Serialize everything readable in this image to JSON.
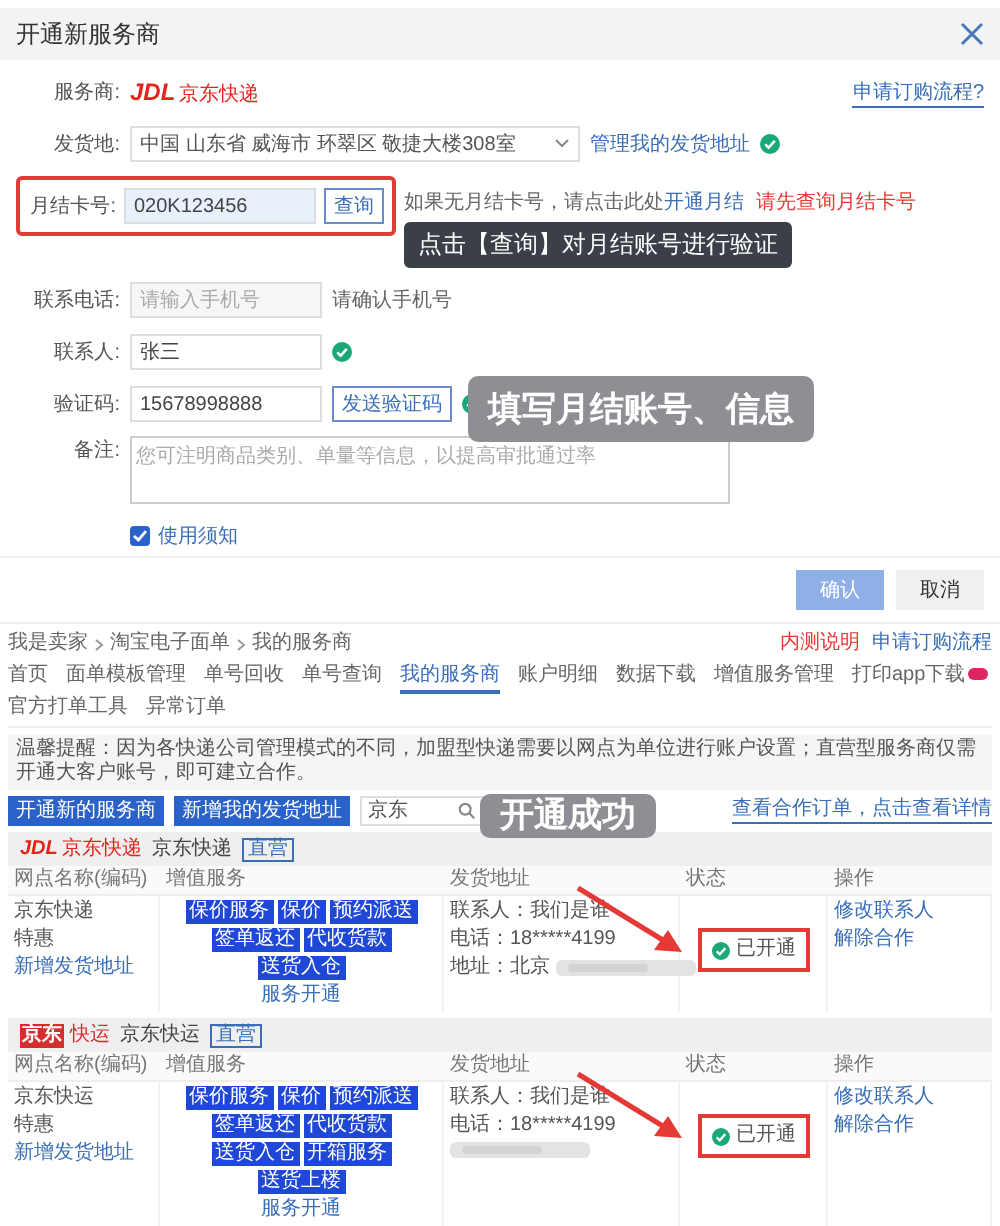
{
  "dialog": {
    "title": "开通新服务商",
    "help_link": "申请订购流程?",
    "provider": {
      "label": "服务商:",
      "logo_mark": "JDL",
      "logo_text": "京东快递"
    },
    "address": {
      "label": "发货地:",
      "value": "中国 山东省 威海市 环翠区 敬捷大楼308室",
      "link": "管理我的发货地址",
      "verified": true
    },
    "account": {
      "label": "月结卡号:",
      "value": "020K123456",
      "button": "查询",
      "hint": "如果无月结卡号，请点击此处",
      "hint_link": "开通月结",
      "warning": "请先查询月结卡号",
      "highlighted": true
    },
    "tooltip": "点击【查询】对月结账号进行验证",
    "phone": {
      "label": "联系电话:",
      "placeholder": "请输入手机号",
      "hint": "请确认手机号"
    },
    "contact": {
      "label": "联系人:",
      "value": "张三",
      "verified": true
    },
    "code": {
      "label": "验证码:",
      "value": "15678998888",
      "button": "发送验证码",
      "verified": true
    },
    "banner": "填写月结账号、信息",
    "note": {
      "label": "备注:",
      "placeholder": "您可注明商品类别、单量等信息，以提高审批通过率"
    },
    "agreement": {
      "label": "使用须知",
      "checked": true
    },
    "buttons": [
      {
        "label": "确认",
        "kind": "primary",
        "disabled": true
      },
      {
        "label": "取消",
        "kind": "default",
        "disabled": false
      }
    ]
  },
  "page": {
    "breadcrumb": [
      "我是卖家",
      "淘宝电子面单",
      "我的服务商"
    ],
    "top_links": [
      "内测说明",
      "申请订购流程"
    ],
    "tabs": [
      {
        "label": "首页",
        "selected": false,
        "badge": false
      },
      {
        "label": "面单模板管理",
        "selected": false,
        "badge": false
      },
      {
        "label": "单号回收",
        "selected": false,
        "badge": false
      },
      {
        "label": "单号查询",
        "selected": false,
        "badge": false
      },
      {
        "label": "我的服务商",
        "selected": true,
        "badge": false
      },
      {
        "label": "账户明细",
        "selected": false,
        "badge": false
      },
      {
        "label": "数据下载",
        "selected": false,
        "badge": false
      },
      {
        "label": "增值服务管理",
        "selected": false,
        "badge": false
      },
      {
        "label": "打印app下载",
        "selected": false,
        "badge": true
      },
      {
        "label": "官方打单工具",
        "selected": false,
        "badge": false
      },
      {
        "label": "异常订单",
        "selected": false,
        "badge": false
      }
    ],
    "notice": "温馨提醒：因为各快递公司管理模式的不同，加盟型快递需要以网点为单位进行账户设置；直营型服务商仅需开通大客户账号，即可建立合作。",
    "banner": "开通成功",
    "toolbar": {
      "buttons": [
        "开通新的服务商",
        "新增我的发货地址"
      ],
      "search_value": "京东",
      "link": "查看合作订单，点击查看详情"
    },
    "providers": [
      {
        "columns": [
          "网点名称(编码)",
          "增值服务",
          "发货地址",
          "状态",
          "操作"
        ],
        "kind": "jdl",
        "logo_mark": "JDL",
        "logo_text": "京东快递",
        "name": "京东快递",
        "tag": "直营",
        "site_name": "京东快递",
        "site_type": "特惠",
        "site_link": "新增发货地址",
        "services": [
          "保价服务",
          "保价",
          "预约派送",
          "签单返还",
          "代收货款",
          "送货入仓"
        ],
        "service_link": "服务开通",
        "contact": "联系人：我们是谁",
        "phone": "电话：18*****4199",
        "address": "地址：北京",
        "status": "已开通",
        "status_highlighted": true,
        "actions": [
          "修改联系人",
          "解除合作"
        ]
      },
      {
        "columns": [
          "网点名称(编码)",
          "增值服务",
          "发货地址",
          "状态",
          "操作"
        ],
        "kind": "freight",
        "logo_mark": "京东",
        "logo_text": "快运",
        "name": "京东快运",
        "tag": "直营",
        "site_name": "京东快运",
        "site_type": "特惠",
        "site_link": "新增发货地址",
        "services": [
          "保价服务",
          "保价",
          "预约派送",
          "签单返还",
          "代收货款",
          "送货入仓",
          "开箱服务",
          "送货上楼"
        ],
        "service_link": "服务开通",
        "contact": "联系人：我们是谁",
        "phone": "电话：18*****4199",
        "status": "已开通",
        "status_highlighted": true,
        "actions": [
          "修改联系人",
          "解除合作"
        ]
      }
    ]
  }
}
